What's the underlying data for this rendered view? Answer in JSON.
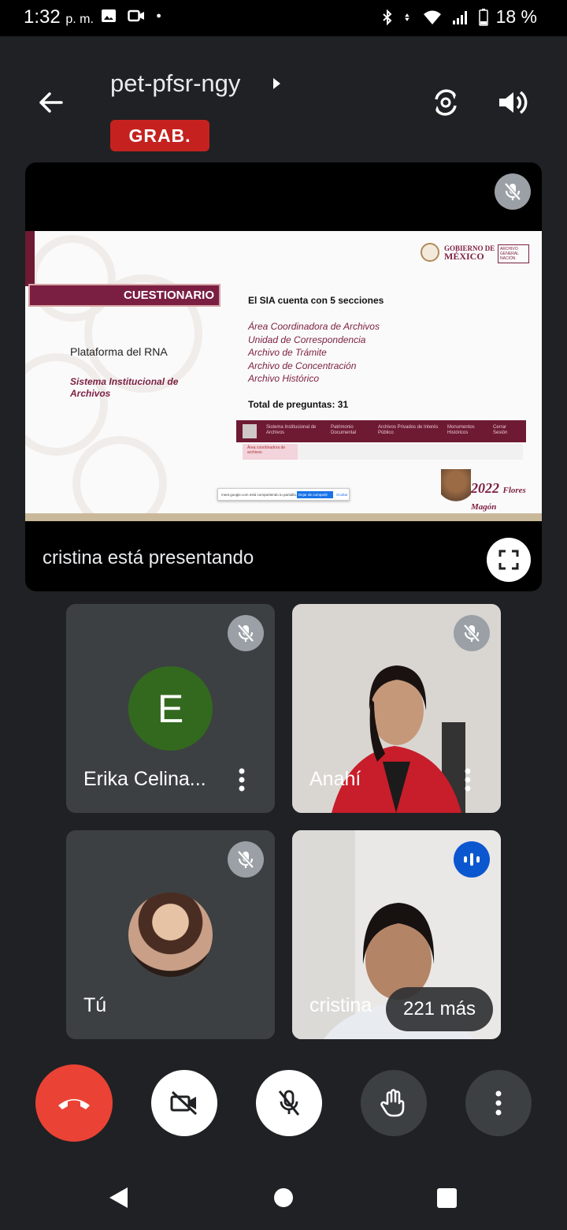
{
  "status_bar": {
    "time": "1:32",
    "time_suffix": "p. m.",
    "battery": "18 %"
  },
  "header": {
    "meeting_code": "pet-pfsr-ngy",
    "recording_badge": "GRAB."
  },
  "presentation": {
    "presenting_label": "cristina está presentando",
    "slide": {
      "heading": "CUESTIONARIO",
      "platform": "Plataforma del RNA",
      "system": "Sistema Institucional de Archivos",
      "sections_intro": "El SIA cuenta con 5 secciones",
      "sections": [
        "Área Coordinadora de Archivos",
        "Unidad de Correspondencia",
        "Archivo de Trámite",
        "Archivo de Concentración",
        "Archivo Histórico"
      ],
      "total": "Total de preguntas: 31",
      "gob_line1": "GOBIERNO DE",
      "gob_line2": "MÉXICO",
      "year": "2022",
      "flores": "Flores Magón"
    }
  },
  "participants": [
    {
      "name": "Erika Celina...",
      "initial": "E",
      "muted": true
    },
    {
      "name": "Anahí",
      "muted": true
    },
    {
      "name": "Tú",
      "muted": true
    },
    {
      "name": "cristina",
      "speaking": true
    }
  ],
  "more_participants": "221 más",
  "colors": {
    "background": "#202124",
    "tile": "#3c4043",
    "end_call": "#ea4335",
    "recording": "#c5221f",
    "speaking": "#0b57d0",
    "slide_accent": "#7b1f42"
  }
}
